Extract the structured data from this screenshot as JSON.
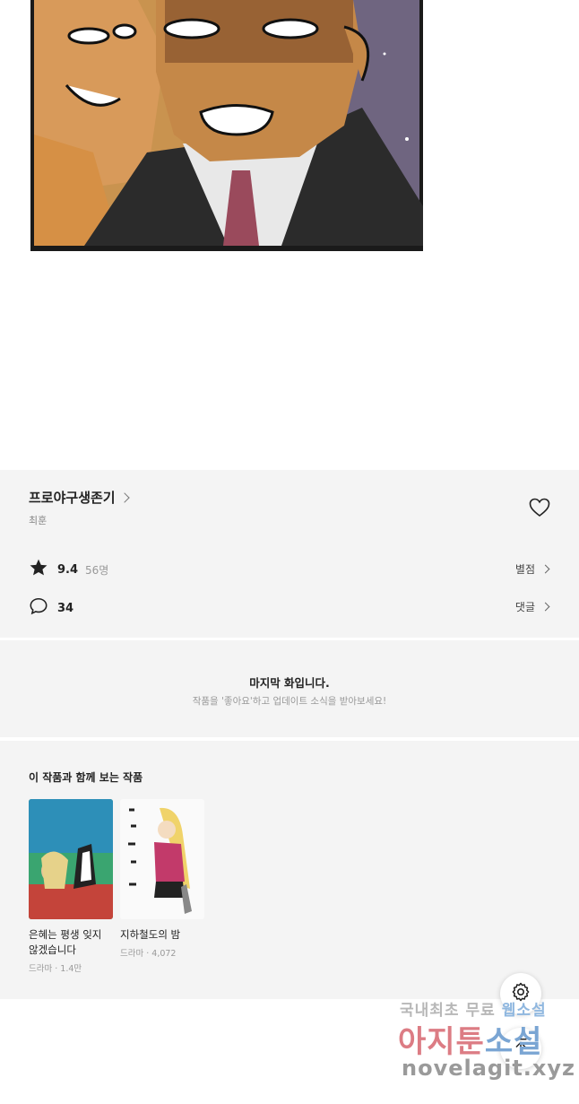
{
  "series": {
    "title": "프로야구생존기",
    "author": "최훈",
    "rating": "9.4",
    "rating_count": "56명",
    "rate_link": "별점",
    "comment_count": "34",
    "comment_link": "댓글"
  },
  "last_episode": {
    "title": "마지막 화입니다.",
    "subtitle": "작품을 '좋아요'하고 업데이트 소식을 받아보세요!"
  },
  "related": {
    "heading": "이 작품과 함께 보는 작품",
    "items": [
      {
        "title": "은혜는 평생 잊지 않겠습니다",
        "meta": "드라마 · 1.4만",
        "cover_text": "은혜는 평생 잊지 않겠습니다"
      },
      {
        "title": "지하철도의 밤",
        "meta": "드라마 · 4,072",
        "cover_text": "지하철도의 밤"
      }
    ]
  },
  "watermark": {
    "line1": "국내최초 무료",
    "line1_highlight": "웹소설",
    "line2": "아지툰",
    "line2_highlight": "소설",
    "line3": "novelagit.xyz"
  },
  "icons": [
    "star-icon",
    "comment-icon",
    "heart-icon",
    "gear-icon",
    "arrow-up-icon"
  ]
}
